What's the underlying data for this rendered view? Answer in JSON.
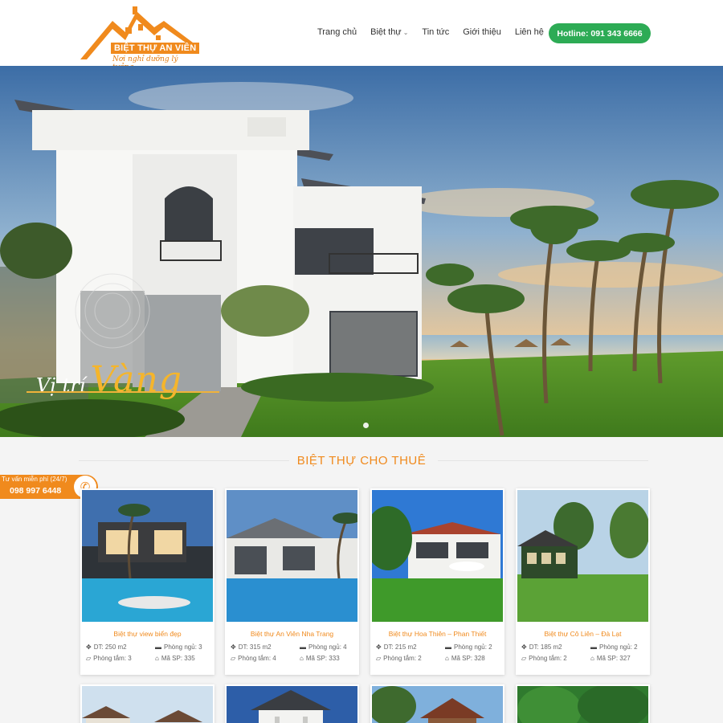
{
  "header": {
    "logo_title": "BIỆT THỰ AN VIÊN",
    "logo_subtitle": "Nơi nghỉ dưỡng lý tưởng",
    "nav": [
      {
        "label": "Trang chủ",
        "has_dropdown": false
      },
      {
        "label": "Biệt thự",
        "has_dropdown": true
      },
      {
        "label": "Tin tức",
        "has_dropdown": false
      },
      {
        "label": "Giới thiệu",
        "has_dropdown": false
      },
      {
        "label": "Liên hệ",
        "has_dropdown": false
      }
    ],
    "hotline_label": "Hotline: 091 343 6666"
  },
  "hero": {
    "caption_small": "Vị trí",
    "caption_big": "Vàng",
    "slide_count": 1,
    "active_slide": 1
  },
  "section": {
    "title": "BIỆT THỰ CHO THUÊ"
  },
  "consult": {
    "label": "Tư vấn miễn phí (24/7)",
    "phone": "098 997 6448",
    "icon": "phone-icon"
  },
  "listings": [
    {
      "title": "Biệt thự view biển đẹp",
      "area": "DT: 250 m2",
      "bedrooms": "Phòng ngủ: 3",
      "bathrooms": "Phòng tắm: 3",
      "code": "Mã SP: 335"
    },
    {
      "title": "Biệt thự An Viên Nha Trang",
      "area": "DT: 315 m2",
      "bedrooms": "Phòng ngủ: 4",
      "bathrooms": "Phòng tắm: 4",
      "code": "Mã SP: 333"
    },
    {
      "title": "Biệt thự Hoa Thiên – Phan Thiết",
      "area": "DT: 215 m2",
      "bedrooms": "Phòng ngủ: 2",
      "bathrooms": "Phòng tắm: 2",
      "code": "Mã SP: 328"
    },
    {
      "title": "Biệt thự Cô Liên – Đà Lạt",
      "area": "DT: 185 m2",
      "bedrooms": "Phòng ngủ: 2",
      "bathrooms": "Phòng tắm: 2",
      "code": "Mã SP: 327"
    }
  ],
  "colors": {
    "accent": "#f08a1d",
    "hotline": "#2dab55",
    "caption_gold": "#f5b52b"
  }
}
